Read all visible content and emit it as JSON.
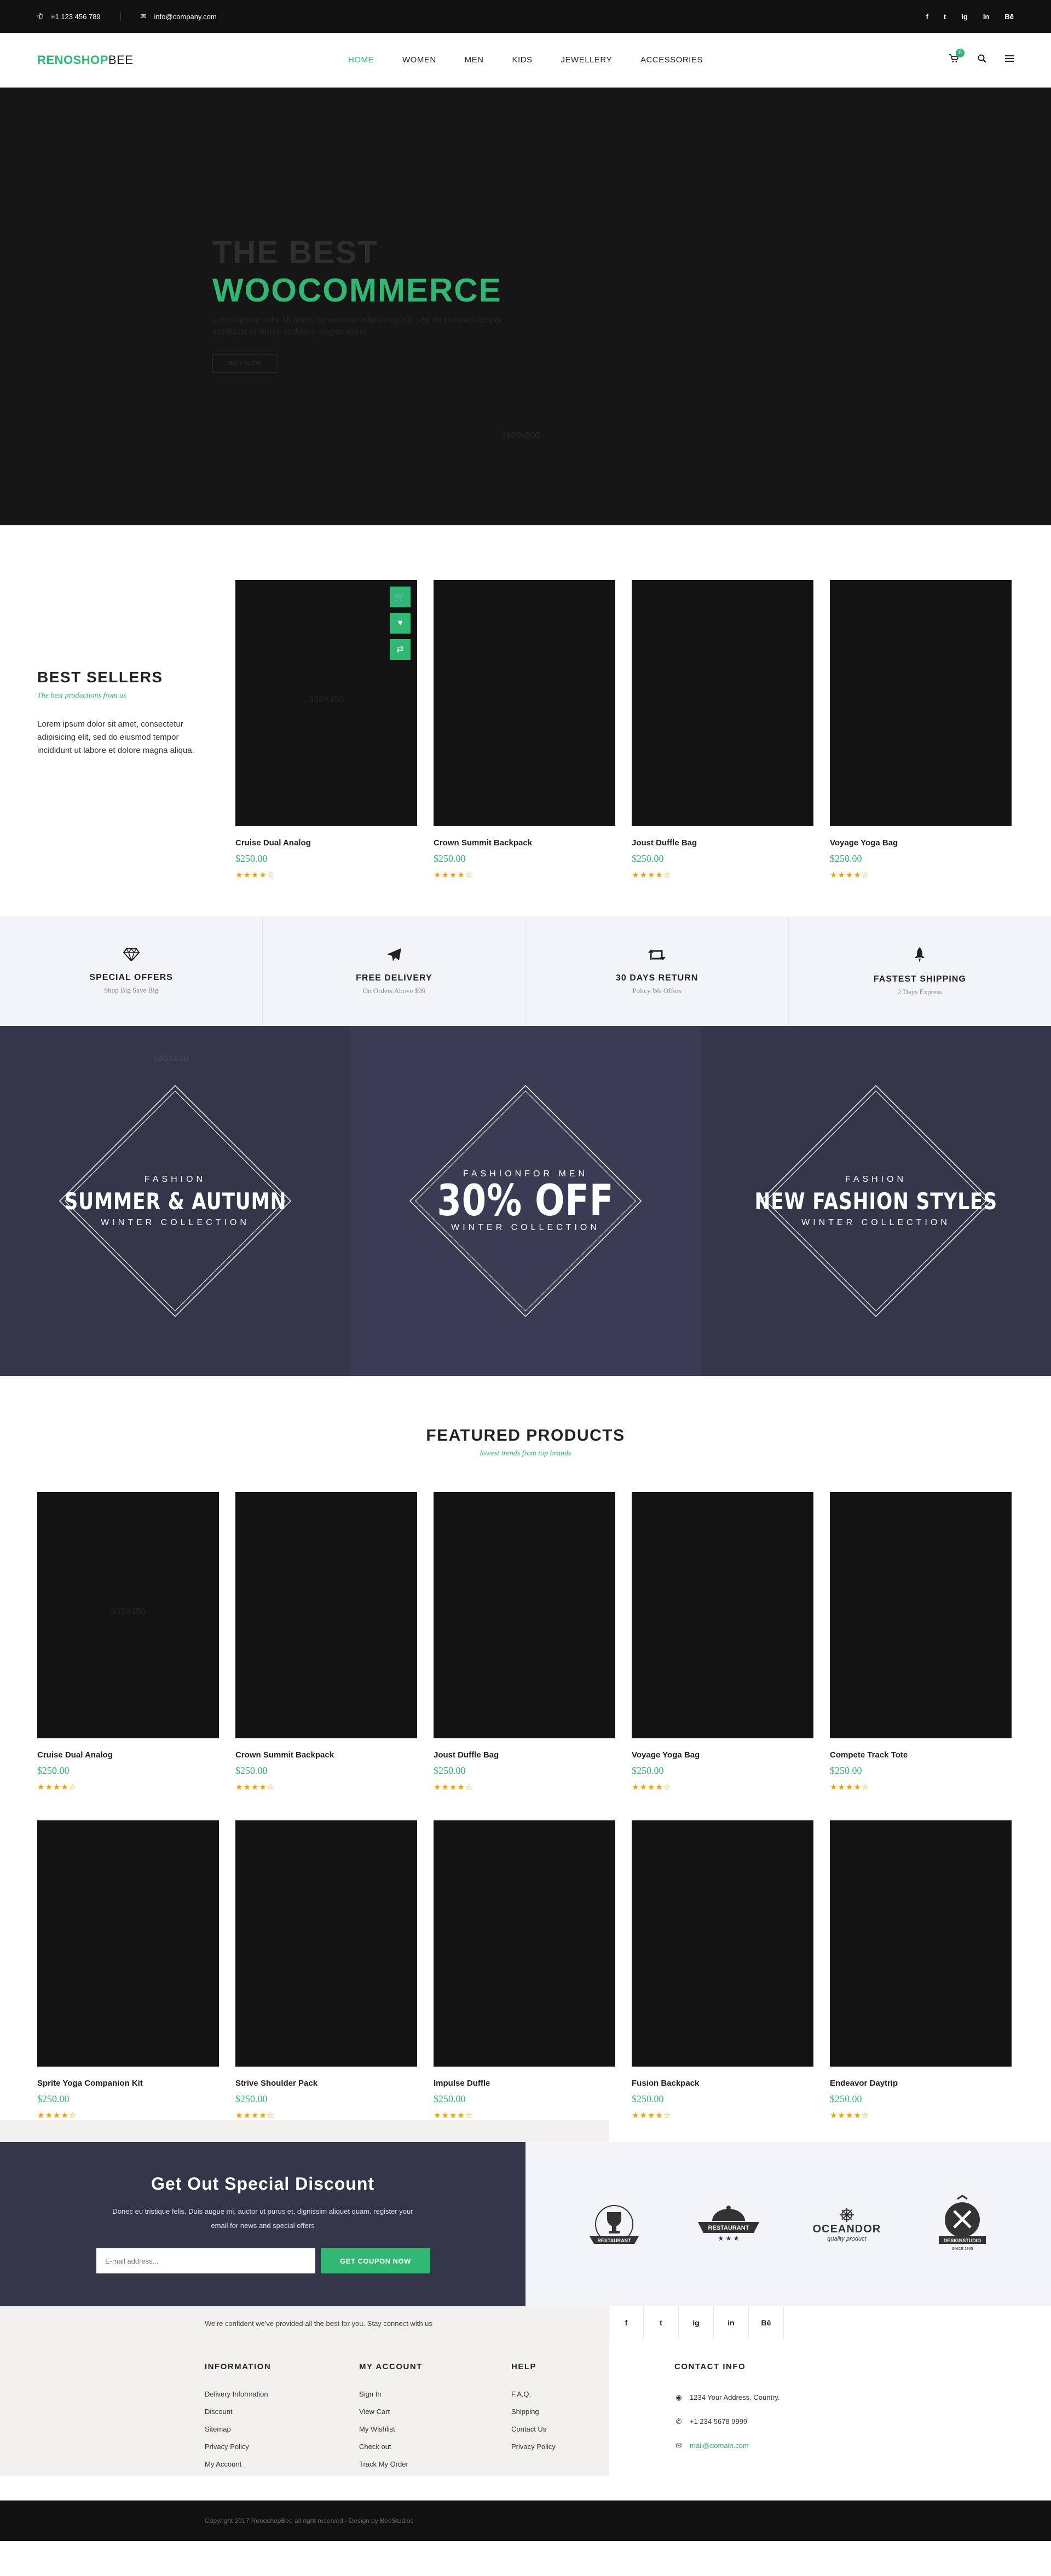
{
  "topbar": {
    "phone": "+1 123 456 789",
    "email": "info@company.com",
    "social": [
      "f",
      "t",
      "ig",
      "in",
      "Bē"
    ]
  },
  "header": {
    "logo_part1": "RENOSHOP",
    "logo_part2": "BEE",
    "nav": [
      "HOME",
      "WOMEN",
      "MEN",
      "KIDS",
      "JEWELLERY",
      "ACCESSORIES"
    ],
    "active_nav": "HOME",
    "cart_count": "0",
    "accent": "#2eb872"
  },
  "hero": {
    "line1": "THE BEST",
    "line2": "WOOCOMMERCE",
    "desc": "Lorem ipsum dolor sit amet, consectetur adipisicing elit, sed do eiusmod tempor incididunt ut labore et dolore magna aliqua.",
    "button": "BUY NOW",
    "placeholder": "1920x800"
  },
  "bestsellers": {
    "title": "BEST SELLERS",
    "subtitle": "The best productions from us",
    "desc": "Lorem ipsum dolor sit amet, consectetur adipisicing elit, sed do eiusmod tempor incididunt ut labore et dolore magna aliqua.",
    "placeholder": "333X450",
    "products": [
      {
        "name": "Cruise Dual Analog",
        "price": "$250.00",
        "rating": 4
      },
      {
        "name": "Crown Summit Backpack",
        "price": "$250.00",
        "rating": 4
      },
      {
        "name": "Joust Duffle Bag",
        "price": "$250.00",
        "rating": 4
      },
      {
        "name": "Voyage Yoga Bag",
        "price": "$250.00",
        "rating": 4
      }
    ]
  },
  "features": [
    {
      "icon": "diamond-icon",
      "title": "SPECIAL OFFERS",
      "sub": "Shop Big Save Big"
    },
    {
      "icon": "paper-plane-icon",
      "title": "FREE DELIVERY",
      "sub": "On Orders Above $99"
    },
    {
      "icon": "retweet-icon",
      "title": "30 DAYS RETURN",
      "sub": "Policy We Offers"
    },
    {
      "icon": "rocket-icon",
      "title": "FASTEST SHIPPING",
      "sub": "2 Days Express"
    }
  ],
  "banners": [
    {
      "top": "FASHION",
      "big": "SUMMER & AUTUMN",
      "bottom": "WINTER COLLECTION",
      "placeholder": "640X640"
    },
    {
      "top": "FASHIONFOR MEN",
      "big": "30% OFF",
      "bottom": "WINTER COLLECTION"
    },
    {
      "top": "FASHION",
      "big": "NEW FASHION STYLES",
      "bottom": "WINTER COLLECTION"
    }
  ],
  "featured": {
    "title": "FEATURED PRODUCTS",
    "subtitle": "lowest trends from top brands",
    "placeholder": "333X450",
    "products": [
      {
        "name": "Cruise Dual Analog",
        "price": "$250.00",
        "rating": 4
      },
      {
        "name": "Crown Summit Backpack",
        "price": "$250.00",
        "rating": 4
      },
      {
        "name": "Joust Duffle Bag",
        "price": "$250.00",
        "rating": 4
      },
      {
        "name": "Voyage Yoga Bag",
        "price": "$250.00",
        "rating": 4
      },
      {
        "name": "Compete Track Tote",
        "price": "$250.00",
        "rating": 4
      },
      {
        "name": "Sprite Yoga Companion Kit",
        "price": "$250.00",
        "rating": 4
      },
      {
        "name": "Strive Shoulder Pack",
        "price": "$250.00",
        "rating": 4
      },
      {
        "name": "Impulse Duffle",
        "price": "$250.00",
        "rating": 4
      },
      {
        "name": "Fusion Backpack",
        "price": "$250.00",
        "rating": 4
      },
      {
        "name": "Endeavor Daytrip",
        "price": "$250.00",
        "rating": 4
      }
    ]
  },
  "discount": {
    "title": "Get Out Special Discount",
    "text": "Donec eu tristique felis. Duis augue mi, auctor ut purus et, dignissim aliquet quam. register your email for news and special offers",
    "placeholder": "E-mail address...",
    "button": "GET COUPON NOW",
    "brands": [
      {
        "name": "RESTAURANT",
        "sub": ""
      },
      {
        "name": "RESTAURANT",
        "sub": ""
      },
      {
        "name": "OCEANDOR",
        "sub": "quality product"
      },
      {
        "name": "DESIGNSTUDIO",
        "sub": "SINCE 1965"
      }
    ]
  },
  "footer": {
    "confident": "We're confident we've provided all the best for you. Stay connect with us",
    "social": [
      "f",
      "t",
      "ig",
      "in",
      "Bē"
    ],
    "information": {
      "title": "INFORMATION",
      "items": [
        "Delivery Information",
        "Discount",
        "Sitemap",
        "Privacy Policy",
        "My Account"
      ]
    },
    "account": {
      "title": "MY ACCOUNT",
      "items": [
        "Sign In",
        "View Cart",
        "My Wishlist",
        "Check out",
        "Track My Order"
      ]
    },
    "help": {
      "title": "HELP",
      "items": [
        "F.A.Q.",
        "Shipping",
        "Contact Us",
        "Privacy Policy"
      ]
    },
    "contact": {
      "title": "CONTACT INFO",
      "address": "1234 Your Address, Country.",
      "phone": "+1 234 5678 9999",
      "email": "mail@domain.com"
    },
    "copyright": "Copyright 2017 RenoshopBee all right reserved  -  Design by BeeStudios"
  }
}
